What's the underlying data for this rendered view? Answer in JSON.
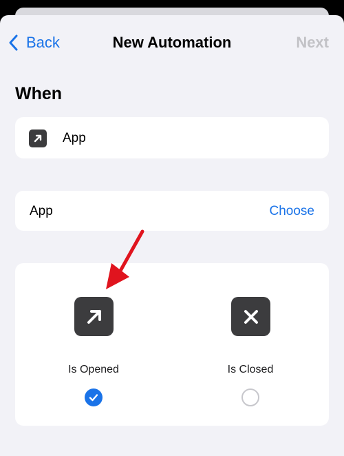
{
  "nav": {
    "back_label": "Back",
    "title": "New Automation",
    "next_label": "Next"
  },
  "when": {
    "section_title": "When",
    "trigger_label": "App"
  },
  "app_row": {
    "label": "App",
    "choose_label": "Choose"
  },
  "events": {
    "opened": {
      "label": "Is Opened",
      "selected": true
    },
    "closed": {
      "label": "Is Closed",
      "selected": false
    }
  },
  "colors": {
    "accent": "#1a73e8",
    "icon_bg": "#3c3c3e",
    "annotation": "#e0141e",
    "background": "#f2f2f7"
  },
  "icons": {
    "trigger": "arrow-up-right-icon",
    "opened": "arrow-up-right-icon",
    "closed": "x-mark-icon"
  }
}
